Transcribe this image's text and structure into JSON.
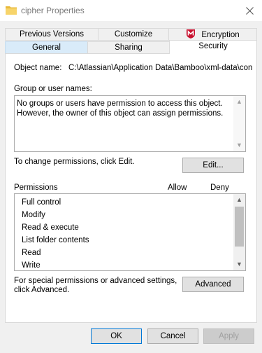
{
  "window": {
    "title": "cipher Properties"
  },
  "tabs": {
    "row1": [
      {
        "label": "Previous Versions"
      },
      {
        "label": "Customize"
      },
      {
        "label": "Encryption"
      }
    ],
    "row2": [
      {
        "label": "General"
      },
      {
        "label": "Sharing"
      },
      {
        "label": "Security"
      }
    ]
  },
  "security": {
    "object_name_label": "Object name:",
    "object_name_value": "C:\\Atlassian\\Application Data\\Bamboo\\xml-data\\con",
    "group_label": "Group or user names:",
    "group_message_line1": "No groups or users have permission to access this object.",
    "group_message_line2": "However, the owner of this object can assign permissions.",
    "change_text": "To change permissions, click Edit.",
    "edit_button": "Edit...",
    "permissions_label": "Permissions",
    "allow_header": "Allow",
    "deny_header": "Deny",
    "permissions": [
      "Full control",
      "Modify",
      "Read & execute",
      "List folder contents",
      "Read",
      "Write"
    ],
    "special_line1": "For special permissions or advanced settings,",
    "special_line2": "click Advanced.",
    "advanced_button": "Advanced"
  },
  "footer": {
    "ok": "OK",
    "cancel": "Cancel",
    "apply": "Apply"
  },
  "colors": {
    "selected_tab_row": "#d9ebf9",
    "button_bg": "#e1e1e1",
    "disabled_text": "#a0a0a0"
  }
}
